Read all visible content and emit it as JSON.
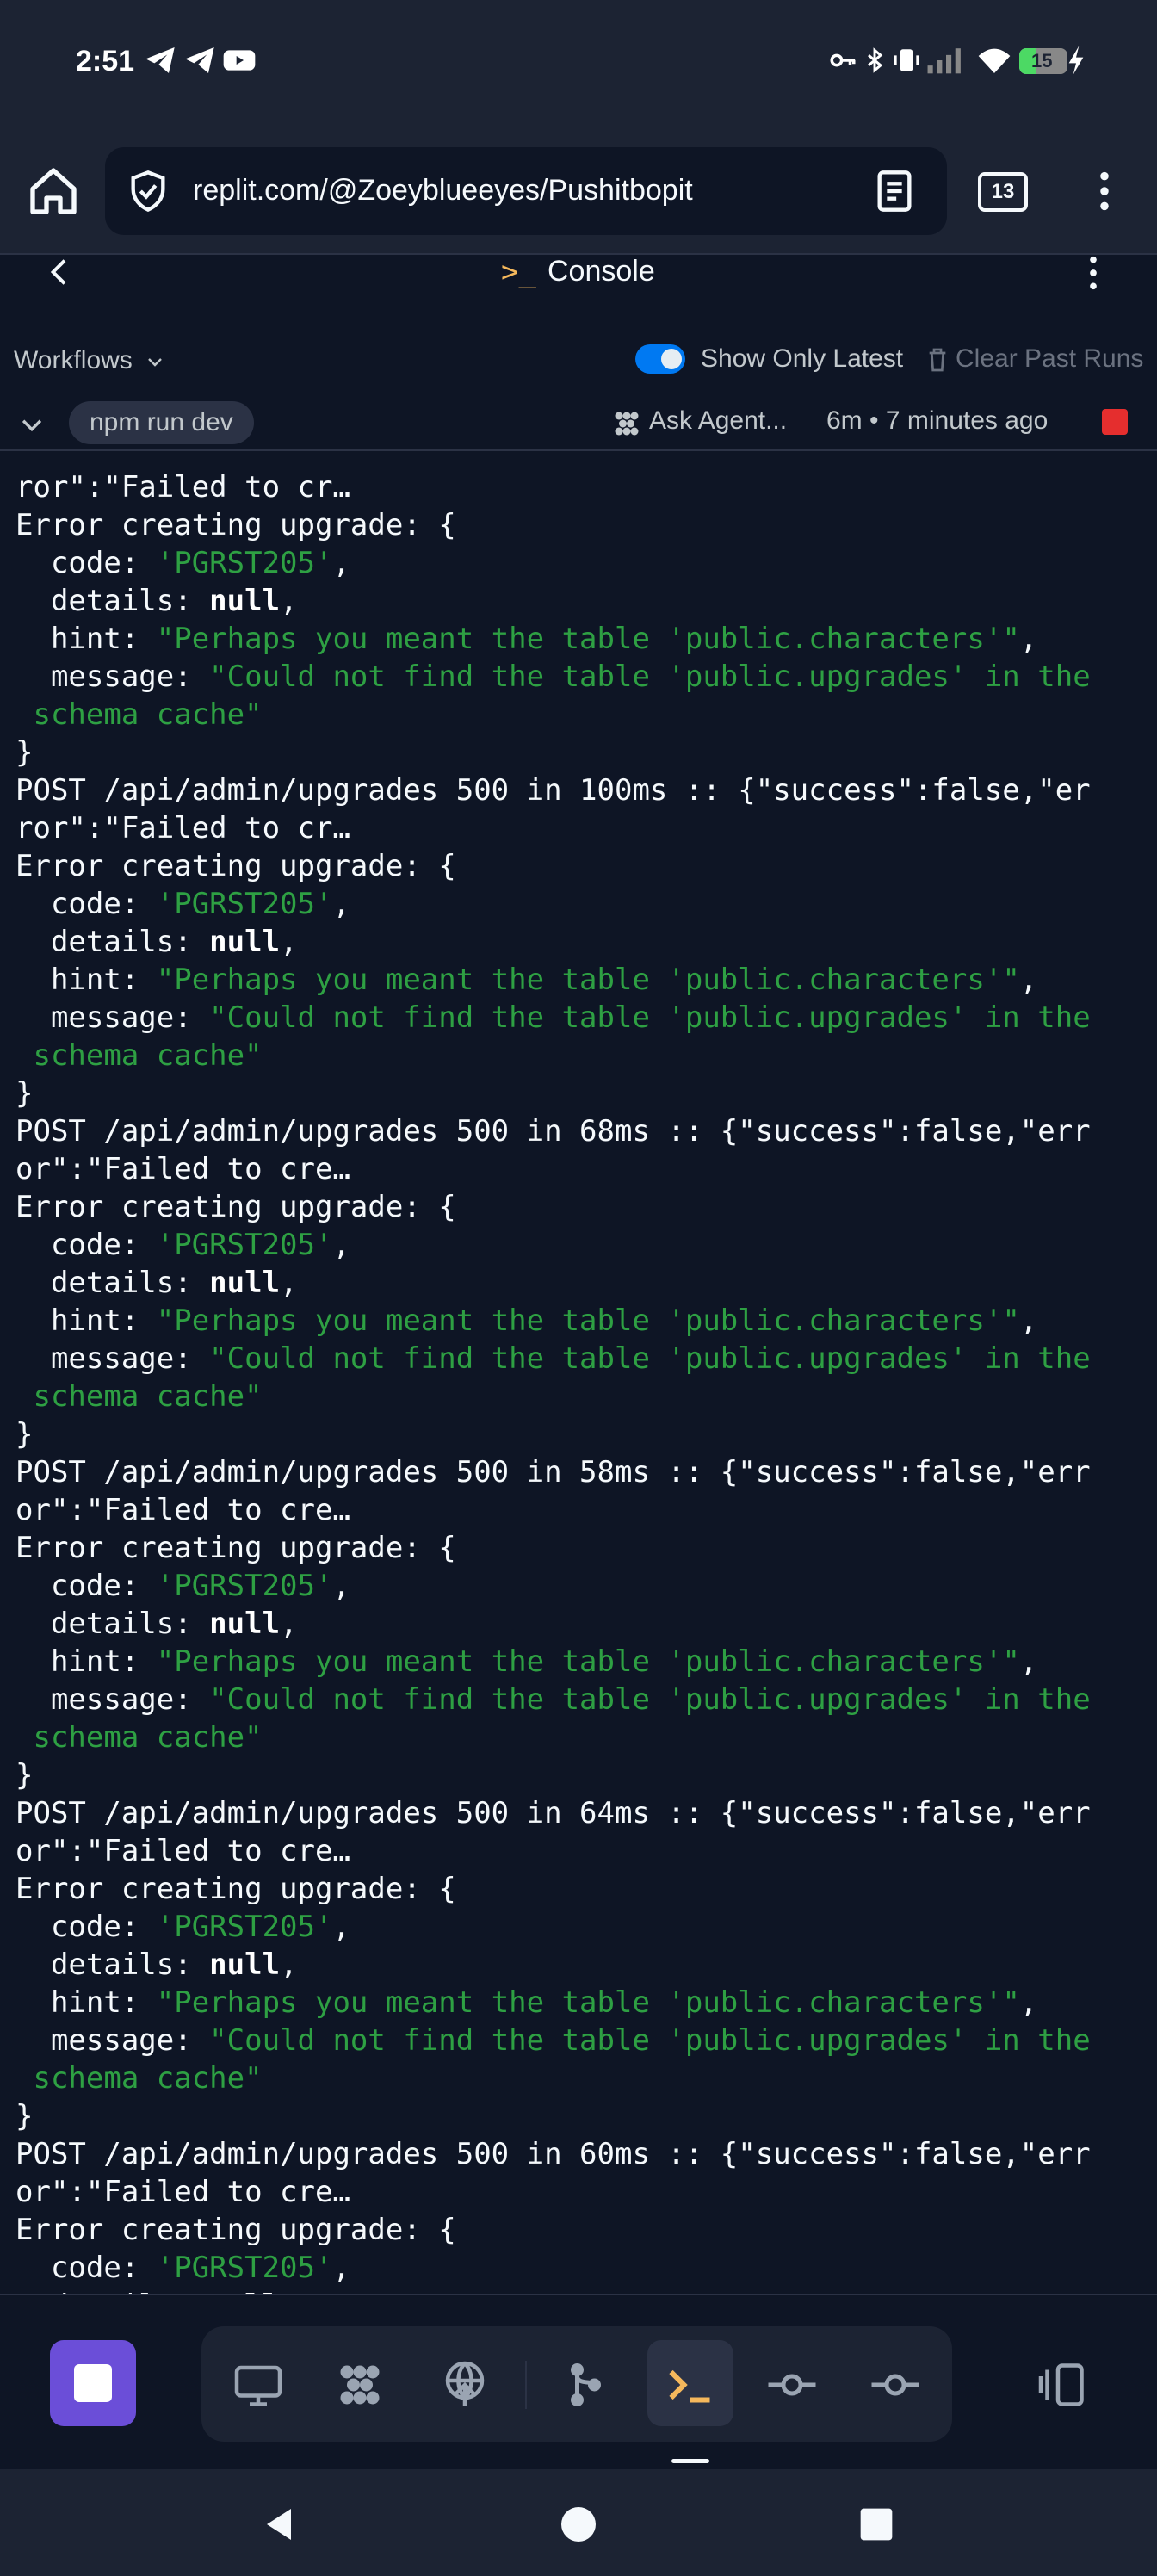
{
  "status_bar": {
    "time": "2:51",
    "battery": "15",
    "icons": [
      "telegram-icon",
      "telegram-icon",
      "youtube-icon",
      "key-icon",
      "bluetooth-icon",
      "vibrate-icon",
      "signal-icon",
      "wifi-icon",
      "battery-icon"
    ]
  },
  "browser": {
    "url": "replit.com/@Zoeyblueeyes/Pushitbopit",
    "tab_count": "13"
  },
  "console_header": {
    "prompt_glyph": ">_",
    "title": "Console"
  },
  "workflows": {
    "label": "Workflows",
    "show_only_latest": "Show Only Latest",
    "clear_past_runs": "Clear Past Runs",
    "run_name": "npm run dev",
    "ask_agent": "Ask Agent...",
    "run_time": "6m • 7 minutes ago"
  },
  "log": {
    "first_line": "ror\":\"Failed to cr…",
    "error_label": "Error creating upgrade: {",
    "code_key": "  code: ",
    "code_value": "'PGRST205'",
    "details_key": "  details: ",
    "details_value": "null",
    "hint_key": "  hint: ",
    "hint_value": "\"Perhaps you meant the table 'public.characters'\"",
    "message_key": "  message: ",
    "message_value_1": "\"Could not find the table 'public.upgrades' in the",
    "message_value_2": " schema cache\"",
    "close_brace": "}",
    "posts": [
      {
        "line1": "POST /api/admin/upgrades 500 in 100ms :: {\"success\":false,\"er",
        "line2": "ror\":\"Failed to cr…"
      },
      {
        "line1": "POST /api/admin/upgrades 500 in 68ms :: {\"success\":false,\"err",
        "line2": "or\":\"Failed to cre…"
      },
      {
        "line1": "POST /api/admin/upgrades 500 in 58ms :: {\"success\":false,\"err",
        "line2": "or\":\"Failed to cre…"
      },
      {
        "line1": "POST /api/admin/upgrades 500 in 64ms :: {\"success\":false,\"err",
        "line2": "or\":\"Failed to cre…"
      },
      {
        "line1": "POST /api/admin/upgrades 500 in 60ms :: {\"success\":false,\"err",
        "line2": "or\":\"Failed to cre…"
      }
    ]
  },
  "colors": {
    "background": "#0e1525",
    "surface": "#1c2333",
    "string_green": "#2ea043",
    "accent_purple": "#6b4ed8",
    "stop_red": "#e52e2e",
    "toggle_blue": "#0079f2",
    "prompt_amber": "#f5b85c"
  }
}
